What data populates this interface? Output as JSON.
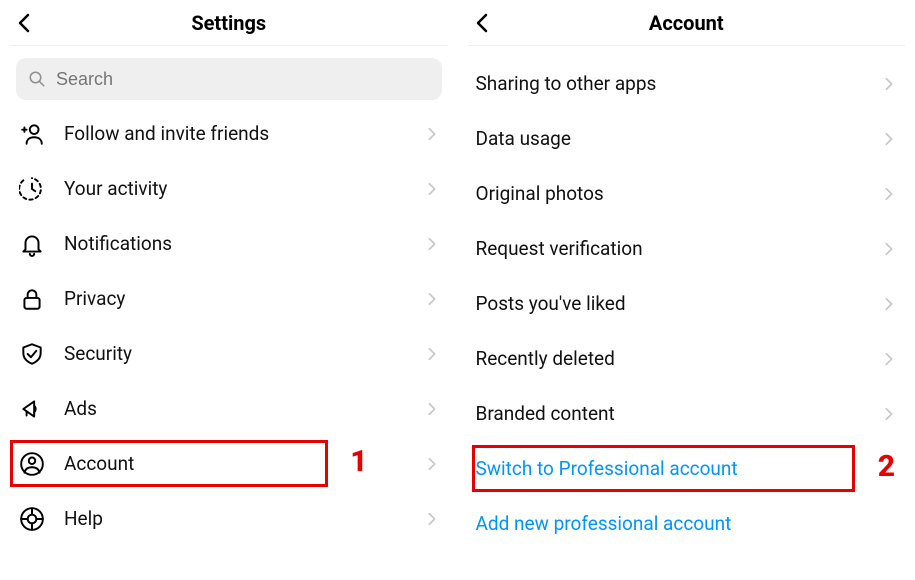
{
  "left": {
    "title": "Settings",
    "search_placeholder": "Search",
    "items": [
      {
        "label": "Follow and invite friends",
        "icon": "invite"
      },
      {
        "label": "Your activity",
        "icon": "activity"
      },
      {
        "label": "Notifications",
        "icon": "bell"
      },
      {
        "label": "Privacy",
        "icon": "lock"
      },
      {
        "label": "Security",
        "icon": "shield"
      },
      {
        "label": "Ads",
        "icon": "ads"
      },
      {
        "label": "Account",
        "icon": "account"
      },
      {
        "label": "Help",
        "icon": "help"
      }
    ],
    "highlight_index": 6,
    "highlight_badge": "1"
  },
  "right": {
    "title": "Account",
    "items": [
      {
        "label": "Sharing to other apps"
      },
      {
        "label": "Data usage"
      },
      {
        "label": "Original photos"
      },
      {
        "label": "Request verification"
      },
      {
        "label": "Posts you've liked"
      },
      {
        "label": "Recently deleted"
      },
      {
        "label": "Branded content"
      },
      {
        "label": "Switch to Professional account",
        "link": true
      },
      {
        "label": "Add new professional account",
        "link": true
      }
    ],
    "highlight_index": 7,
    "highlight_badge": "2"
  }
}
